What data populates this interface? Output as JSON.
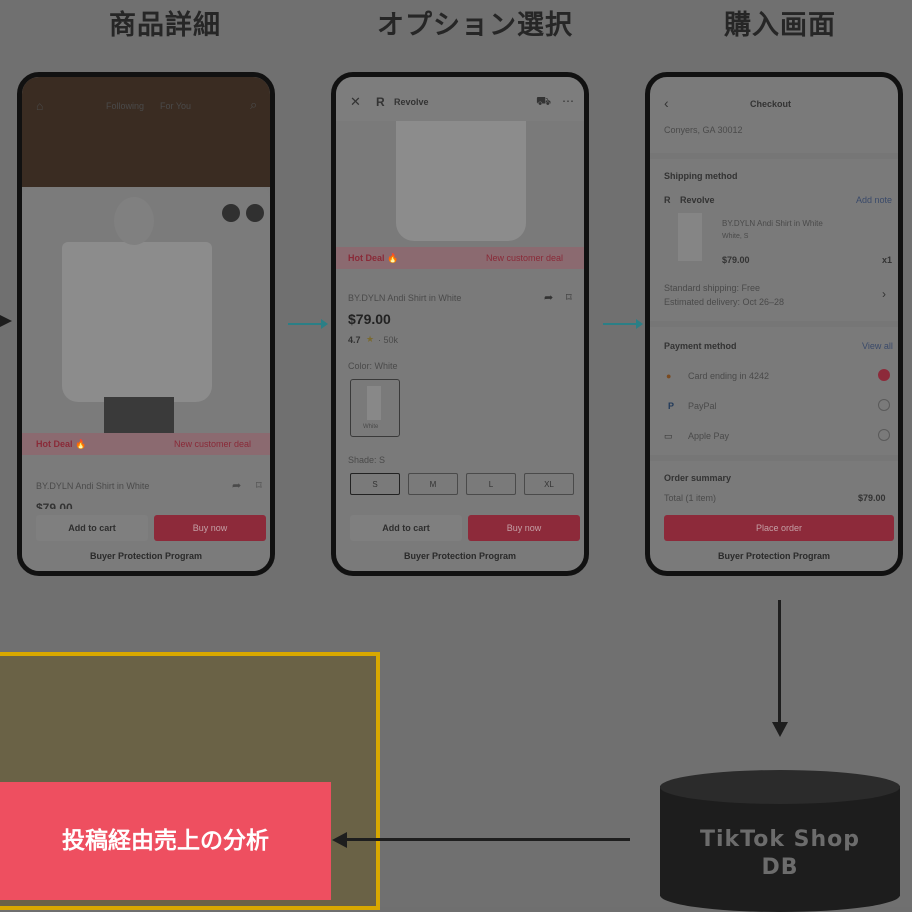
{
  "headings": [
    "商品詳細",
    "オプション選択",
    "購入画面"
  ],
  "phone1": {
    "tabs": [
      "Following",
      "For You"
    ],
    "hot_deal": "Hot Deal 🔥",
    "new_customer": "New customer deal",
    "product_name": "BY.DYLN Andi Shirt in White",
    "price_partial": "$79.00",
    "add_to_cart": "Add to cart",
    "buy_now": "Buy now",
    "protection": "Buyer Protection Program"
  },
  "phone2": {
    "store": "Revolve",
    "hot_deal": "Hot Deal 🔥",
    "new_customer": "New customer deal",
    "product_name": "BY.DYLN Andi Shirt in White",
    "price": "$79.00",
    "rating": "4.7",
    "reviews": "· 50k",
    "color_label": "Color: White",
    "swatch_label": "White",
    "shade_label": "Shade: S",
    "sizes": [
      "S",
      "M",
      "L",
      "XL"
    ],
    "add_to_cart": "Add to cart",
    "buy_now": "Buy now",
    "protection": "Buyer Protection Program"
  },
  "phone3": {
    "title": "Checkout",
    "address": "Conyers, GA 30012",
    "shipping_method": "Shipping method",
    "store": "Revolve",
    "add_note": "Add note",
    "item_name": "BY.DYLN Andi Shirt in White",
    "item_variant": "White, S",
    "item_price": "$79.00",
    "item_qty": "x1",
    "standard_shipping": "Standard shipping: Free",
    "delivery": "Estimated delivery: Oct 26–28",
    "payment_method": "Payment method",
    "view_all": "View all",
    "payments": [
      "Card ending in 4242",
      "PayPal",
      "Apple Pay"
    ],
    "order_summary": "Order summary",
    "total_label": "Total (1 item)",
    "total_value": "$79.00",
    "place_order": "Place order",
    "protection": "Buyer Protection Program"
  },
  "analysis_label": "投稿経由売上の分析",
  "database_label": "TikTok Shop\nDB",
  "colors": {
    "accent_red": "#ee4f60",
    "highlight_border": "#d8a800",
    "flow_arrow": "#2b7f86",
    "database": "#1d1d1d"
  }
}
